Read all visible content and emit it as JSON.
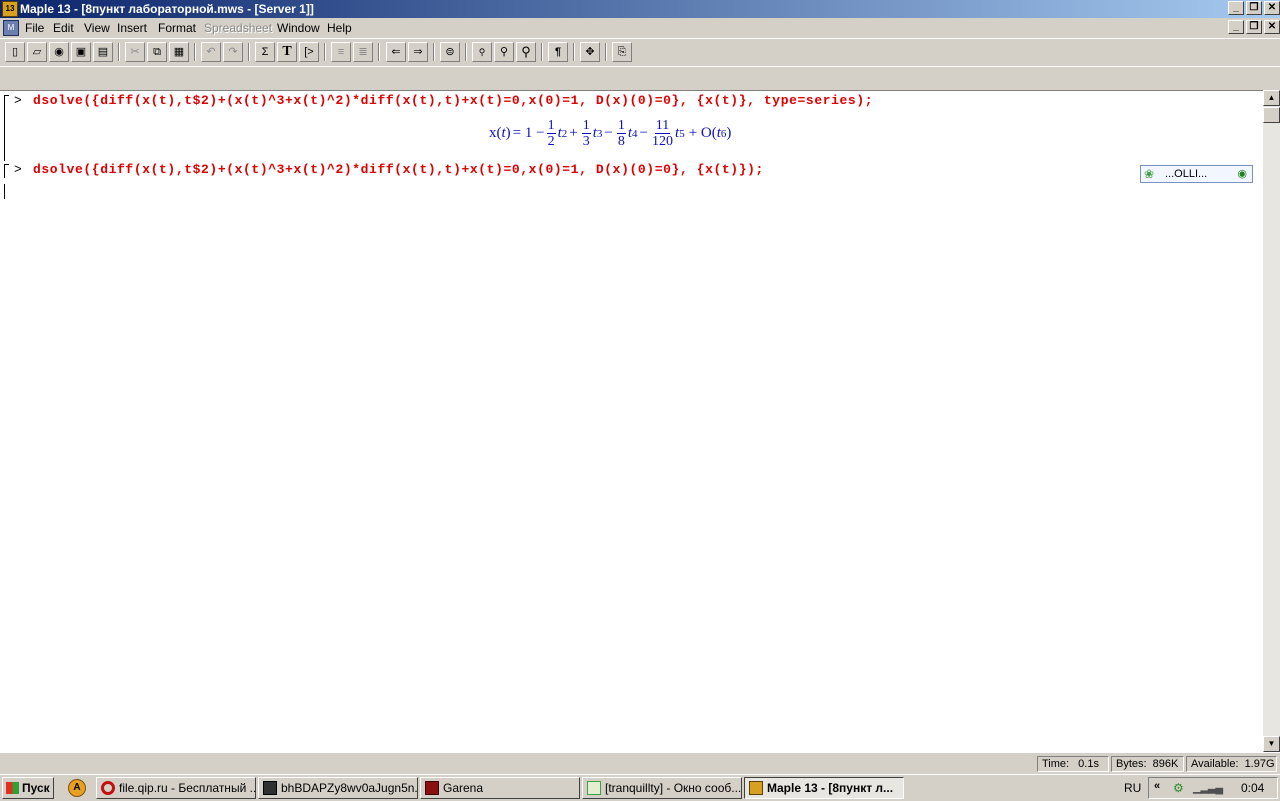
{
  "window": {
    "title": "Maple 13 - [8пункт лабораторной.mws - [Server 1]]",
    "app_icon_text": "13",
    "buttons": [
      "_",
      "❐",
      "✕"
    ]
  },
  "menu": {
    "items": [
      "File",
      "Edit",
      "View",
      "Insert",
      "Format",
      "Spreadsheet",
      "Window",
      "Help"
    ],
    "disabled": [
      "Spreadsheet"
    ]
  },
  "toolbar": {
    "icons": [
      "new-icon",
      "open-icon",
      "open-url-icon",
      "save-icon",
      "print-icon",
      "cut-icon",
      "copy-icon",
      "paste-icon",
      "undo-icon",
      "redo-icon",
      "sigma-icon",
      "text-icon",
      "prompt-icon",
      "indent-icon",
      "outdent-icon",
      "back-icon",
      "forward-icon",
      "stop-icon",
      "zoom-1-icon",
      "zoom-2-icon",
      "zoom-3-icon",
      "pilcrow-icon",
      "expand-icon",
      "restart-icon"
    ],
    "glyphs": {
      "sigma": "Σ",
      "text": "T",
      "prompt": "[>",
      "back": "⇐",
      "forward": "⇒",
      "pilcrow": "¶",
      "expand": "✥"
    }
  },
  "worksheet": {
    "prompt": ">",
    "cmd1": "dsolve({diff(x(t),t$2)+(x(t)^3+x(t)^2)*diff(x(t),t)+x(t)=0,x(0)=1, D(x)(0)=0}, {x(t)}, type=series);",
    "cmd2": "dsolve({diff(x(t),t$2)+(x(t)^3+x(t)^2)*diff(x(t),t)+x(t)=0,x(0)=1, D(x)(0)=0}, {x(t)});",
    "result": {
      "lhs": "x(",
      "var": "t",
      "close": ")",
      "eq_one": " = 1 −",
      "frac1": [
        "1",
        "2"
      ],
      "pow1": "2",
      "plus1": "+",
      "frac2": [
        "1",
        "3"
      ],
      "pow2": "3",
      "minus1": "−",
      "frac3": [
        "1",
        "8"
      ],
      "pow3": "4",
      "minus2": "−",
      "frac4": [
        "11",
        "120"
      ],
      "pow4": "5",
      "plus2": "+ O(",
      "pow5": "6",
      "end": ")"
    }
  },
  "qip_popup": {
    "label": "...OLLI...",
    "flower": "❀",
    "eye": "◉"
  },
  "status": {
    "time_label": "Time:",
    "time_value": "0.1s",
    "bytes_label": "Bytes:",
    "bytes_value": "896K",
    "avail_label": "Available:",
    "avail_value": "1.97G"
  },
  "taskbar": {
    "start": "Пуск",
    "quicklaunch": "A",
    "tasks": [
      {
        "label": "file.qip.ru - Бесплатный ...",
        "icon": "opera-icon",
        "color": "#c01010"
      },
      {
        "label": "bhBDAPZy8wv0aJugn5n...",
        "icon": "image-icon",
        "color": "#404040"
      },
      {
        "label": "Garena",
        "icon": "garena-icon",
        "color": "#a01010"
      },
      {
        "label": "[tranquillty] - Окно сооб...",
        "icon": "chat-icon",
        "color": "#40a040"
      },
      {
        "label": "Maple 13 - [8пункт л...",
        "icon": "maple-icon",
        "color": "#d8a020"
      }
    ],
    "lang": "RU",
    "tray_arrow": "«",
    "clock": "0:04"
  }
}
